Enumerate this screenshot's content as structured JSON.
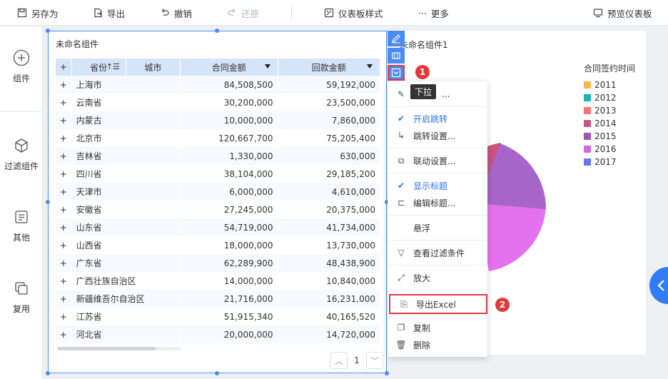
{
  "toolbar": {
    "save_as": "另存为",
    "export": "导出",
    "undo": "撤销",
    "redo": "还原",
    "dashboard_style": "仪表板样式",
    "more": "更多",
    "preview": "预览仪表板"
  },
  "sidebar": {
    "items": [
      {
        "label": "组件"
      },
      {
        "label": "过滤组件"
      },
      {
        "label": "其他"
      },
      {
        "label": "复用"
      }
    ]
  },
  "table_widget": {
    "title": "未命名组件",
    "columns": [
      "+",
      "省份",
      "城市",
      "合同金额",
      "回款金额"
    ],
    "rows": [
      {
        "plus": "+",
        "province": "上海市",
        "contract": "84,508,500",
        "payment": "59,192,000"
      },
      {
        "plus": "+",
        "province": "云南省",
        "contract": "30,200,000",
        "payment": "23,500,000"
      },
      {
        "plus": "+",
        "province": "内蒙古",
        "contract": "10,000,000",
        "payment": "7,860,000"
      },
      {
        "plus": "+",
        "province": "北京市",
        "contract": "120,667,700",
        "payment": "75,205,400"
      },
      {
        "plus": "+",
        "province": "吉林省",
        "contract": "1,330,000",
        "payment": "630,000"
      },
      {
        "plus": "+",
        "province": "四川省",
        "contract": "38,104,000",
        "payment": "29,185,200"
      },
      {
        "plus": "+",
        "province": "天津市",
        "contract": "6,000,000",
        "payment": "4,610,000"
      },
      {
        "plus": "+",
        "province": "安徽省",
        "contract": "27,245,000",
        "payment": "20,375,000"
      },
      {
        "plus": "+",
        "province": "山东省",
        "contract": "54,719,000",
        "payment": "41,734,000"
      },
      {
        "plus": "+",
        "province": "山西省",
        "contract": "18,000,000",
        "payment": "13,730,000"
      },
      {
        "plus": "+",
        "province": "广东省",
        "contract": "62,289,900",
        "payment": "48,438,900"
      },
      {
        "plus": "+",
        "province": "广西壮族自治区",
        "contract": "14,000,000",
        "payment": "10,840,000"
      },
      {
        "plus": "+",
        "province": "新疆维吾尔自治区",
        "contract": "21,716,000",
        "payment": "16,231,000"
      },
      {
        "plus": "+",
        "province": "江苏省",
        "contract": "51,915,340",
        "payment": "40,165,520"
      },
      {
        "plus": "+",
        "province": "河北省",
        "contract": "20,000,000",
        "payment": "14,720,000"
      }
    ],
    "page": "1"
  },
  "pie_widget": {
    "title": "未命名组件1",
    "legend_title": "合同签约时间",
    "legend": [
      {
        "label": "2011",
        "color": "#f5b94d"
      },
      {
        "label": "2012",
        "color": "#1bb3b8"
      },
      {
        "label": "2013",
        "color": "#f07674"
      },
      {
        "label": "2014",
        "color": "#c85384"
      },
      {
        "label": "2015",
        "color": "#9b59b6"
      },
      {
        "label": "2016",
        "color": "#d36ae0"
      },
      {
        "label": "2017",
        "color": "#6476e8"
      }
    ]
  },
  "menu": {
    "tooltip": "下拉",
    "items": [
      {
        "label": "..."
      },
      {
        "label": "开启跳转"
      },
      {
        "label": "跳转设置..."
      },
      {
        "label": "联动设置..."
      },
      {
        "label": "显示标题"
      },
      {
        "label": "编辑标题..."
      },
      {
        "label": "悬浮"
      },
      {
        "label": "查看过滤条件"
      },
      {
        "label": "放大"
      },
      {
        "label": "导出Excel"
      },
      {
        "label": "复制"
      },
      {
        "label": "删除"
      }
    ]
  },
  "badges": {
    "one": "1",
    "two": "2"
  },
  "colors": {
    "accent": "#4b8bf4",
    "highlight": "#e4393c",
    "header_bg": "#d6e4f7",
    "fab": "#2f7cf6"
  }
}
